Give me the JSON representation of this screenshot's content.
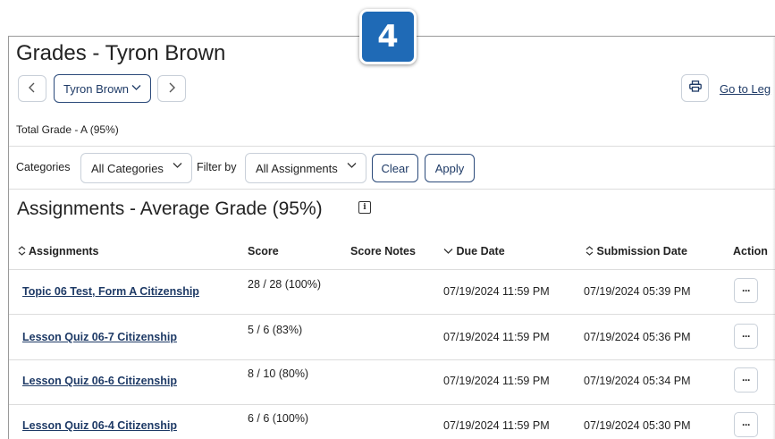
{
  "step_badge": "4",
  "header": {
    "title": "Grades - Tyron Brown",
    "student_selector": "Tyron Brown",
    "legend_link": "Go to Leg"
  },
  "total_grade": "Total Grade - A (95%)",
  "filters": {
    "categories_label": "Categories",
    "categories_value": "All Categories",
    "filter_by_label": "Filter by",
    "filter_by_value": "All Assignments",
    "clear_label": "Clear",
    "apply_label": "Apply"
  },
  "section_title": "Assignments - Average Grade (95%)",
  "table": {
    "columns": [
      "Assignments",
      "Score",
      "Score Notes",
      "Due Date",
      "Submission Date",
      "Action"
    ],
    "rows": [
      {
        "assignment": "Topic 06 Test, Form A Citizenship",
        "score": "28 / 28 (100%)",
        "notes": "",
        "due": "07/19/2024 11:59 PM",
        "submitted": "07/19/2024 05:39 PM"
      },
      {
        "assignment": "Lesson Quiz 06-7 Citizenship",
        "score": "5 / 6 (83%)",
        "notes": "",
        "due": "07/19/2024 11:59 PM",
        "submitted": "07/19/2024 05:36 PM"
      },
      {
        "assignment": "Lesson Quiz 06-6 Citizenship",
        "score": "8 / 10 (80%)",
        "notes": "",
        "due": "07/19/2024 11:59 PM",
        "submitted": "07/19/2024 05:34 PM"
      },
      {
        "assignment": "Lesson Quiz 06-4 Citizenship",
        "score": "6 / 6 (100%)",
        "notes": "",
        "due": "07/19/2024 11:59 PM",
        "submitted": "07/19/2024 05:30 PM"
      }
    ]
  },
  "icons": {
    "prev": "chevron-left-icon",
    "next": "chevron-right-icon",
    "print": "printer-icon",
    "info": "info-icon",
    "sort": "sort-icon",
    "more": "more-options-icon"
  },
  "colors": {
    "badge": "#1f6ab6",
    "link": "#1e3a66",
    "border": "#c9d0d9"
  }
}
